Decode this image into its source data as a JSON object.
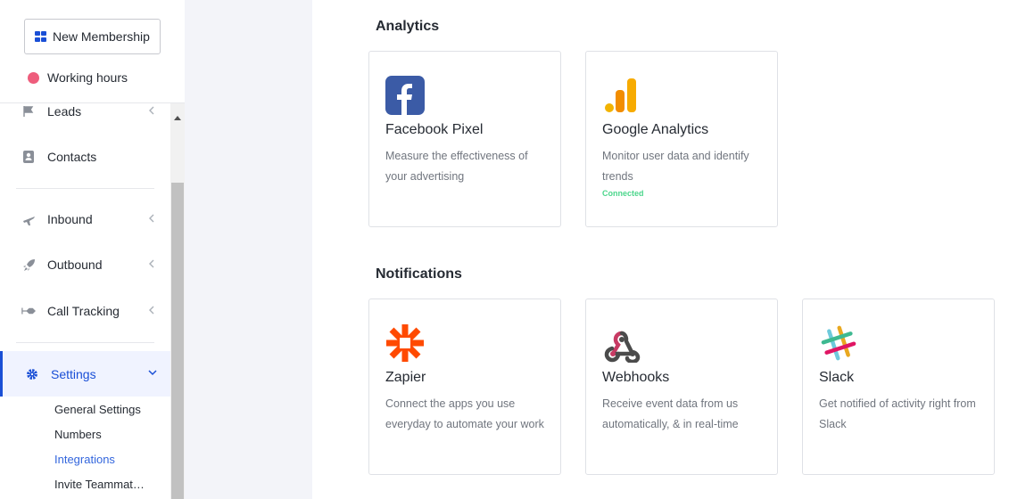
{
  "sidebar": {
    "new_button": "New Membership",
    "working_hours": "Working hours",
    "items": [
      {
        "label": "Leads"
      },
      {
        "label": "Contacts"
      },
      {
        "label": "Inbound"
      },
      {
        "label": "Outbound"
      },
      {
        "label": "Call Tracking"
      },
      {
        "label": "Settings"
      }
    ],
    "settings_sub": [
      {
        "label": "General Settings"
      },
      {
        "label": "Numbers"
      },
      {
        "label": "Integrations"
      },
      {
        "label": "Invite Teammat…"
      }
    ]
  },
  "main": {
    "analytics_title": "Analytics",
    "notifications_title": "Notifications",
    "analytics_cards": [
      {
        "title": "Facebook Pixel",
        "desc": "Measure the effectiveness of your advertising",
        "icon": "facebook-icon"
      },
      {
        "title": "Google Analytics",
        "desc": "Monitor user data and identify trends",
        "status": "Connected",
        "icon": "google-analytics-icon"
      }
    ],
    "notification_cards": [
      {
        "title": "Zapier",
        "desc": "Connect the apps you use everyday to automate your work",
        "icon": "zapier-icon"
      },
      {
        "title": "Webhooks",
        "desc": "Receive event data from us automatically, & in real-time",
        "icon": "webhooks-icon"
      },
      {
        "title": "Slack",
        "desc": "Get notified of activity right from Slack",
        "icon": "slack-icon"
      }
    ]
  },
  "colors": {
    "accent": "#1a4fd6",
    "working_dot": "#ee5d7c",
    "connected": "#4cd68c",
    "gutter": "#f3f4f9"
  }
}
